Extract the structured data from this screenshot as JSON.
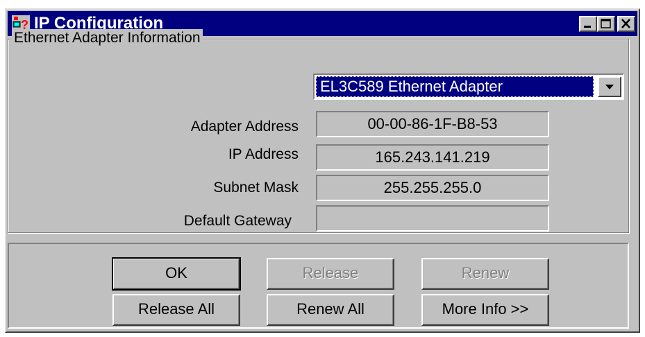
{
  "window": {
    "title": "IP Configuration",
    "icons": {
      "app": "network-question-icon",
      "minimize": "minimize-icon",
      "maximize": "maximize-icon",
      "close": "close-icon"
    }
  },
  "group": {
    "label": "Ethernet  Adapter Information"
  },
  "adapter_select": {
    "selected": "EL3C589 Ethernet Adapter",
    "icon": "chevron-down-icon"
  },
  "fields": [
    {
      "label": "Adapter Address",
      "value": "00-00-86-1F-B8-53"
    },
    {
      "label": "IP Address",
      "value": "165.243.141.219"
    },
    {
      "label": "Subnet Mask",
      "value": "255.255.255.0"
    },
    {
      "label": "Default Gateway",
      "value": ""
    }
  ],
  "buttons": {
    "ok": "OK",
    "release": "Release",
    "renew": "Renew",
    "release_all": "Release All",
    "renew_all": "Renew All",
    "more_info": "More Info >>"
  },
  "colors": {
    "titlebar": "#000080",
    "face": "#c0c0c0",
    "selection": "#000080"
  }
}
